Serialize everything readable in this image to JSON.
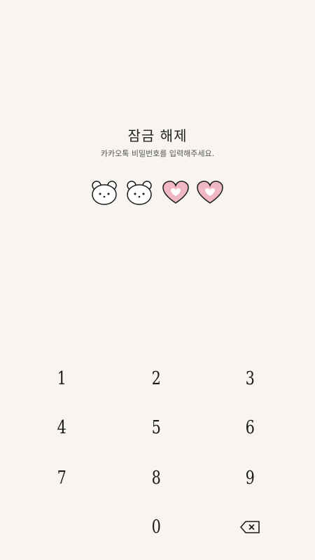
{
  "header": {
    "title": "잠금 해제",
    "subtitle": "카카오톡 비밀번호를 입력해주세요."
  },
  "pin": {
    "length": 4,
    "entered": 2,
    "filled_icon": "bear-face-icon",
    "empty_icon": "heart-icon",
    "colors": {
      "heart_fill": "#f0b8c4",
      "heart_inner": "#ffffff",
      "bear_fill": "#ffffff",
      "outline": "#1a1a1a"
    }
  },
  "keypad": {
    "keys": [
      "1",
      "2",
      "3",
      "4",
      "5",
      "6",
      "7",
      "8",
      "9",
      "",
      "0",
      ""
    ],
    "backspace_icon": "backspace-icon"
  },
  "colors": {
    "background": "#f8f5f1"
  }
}
